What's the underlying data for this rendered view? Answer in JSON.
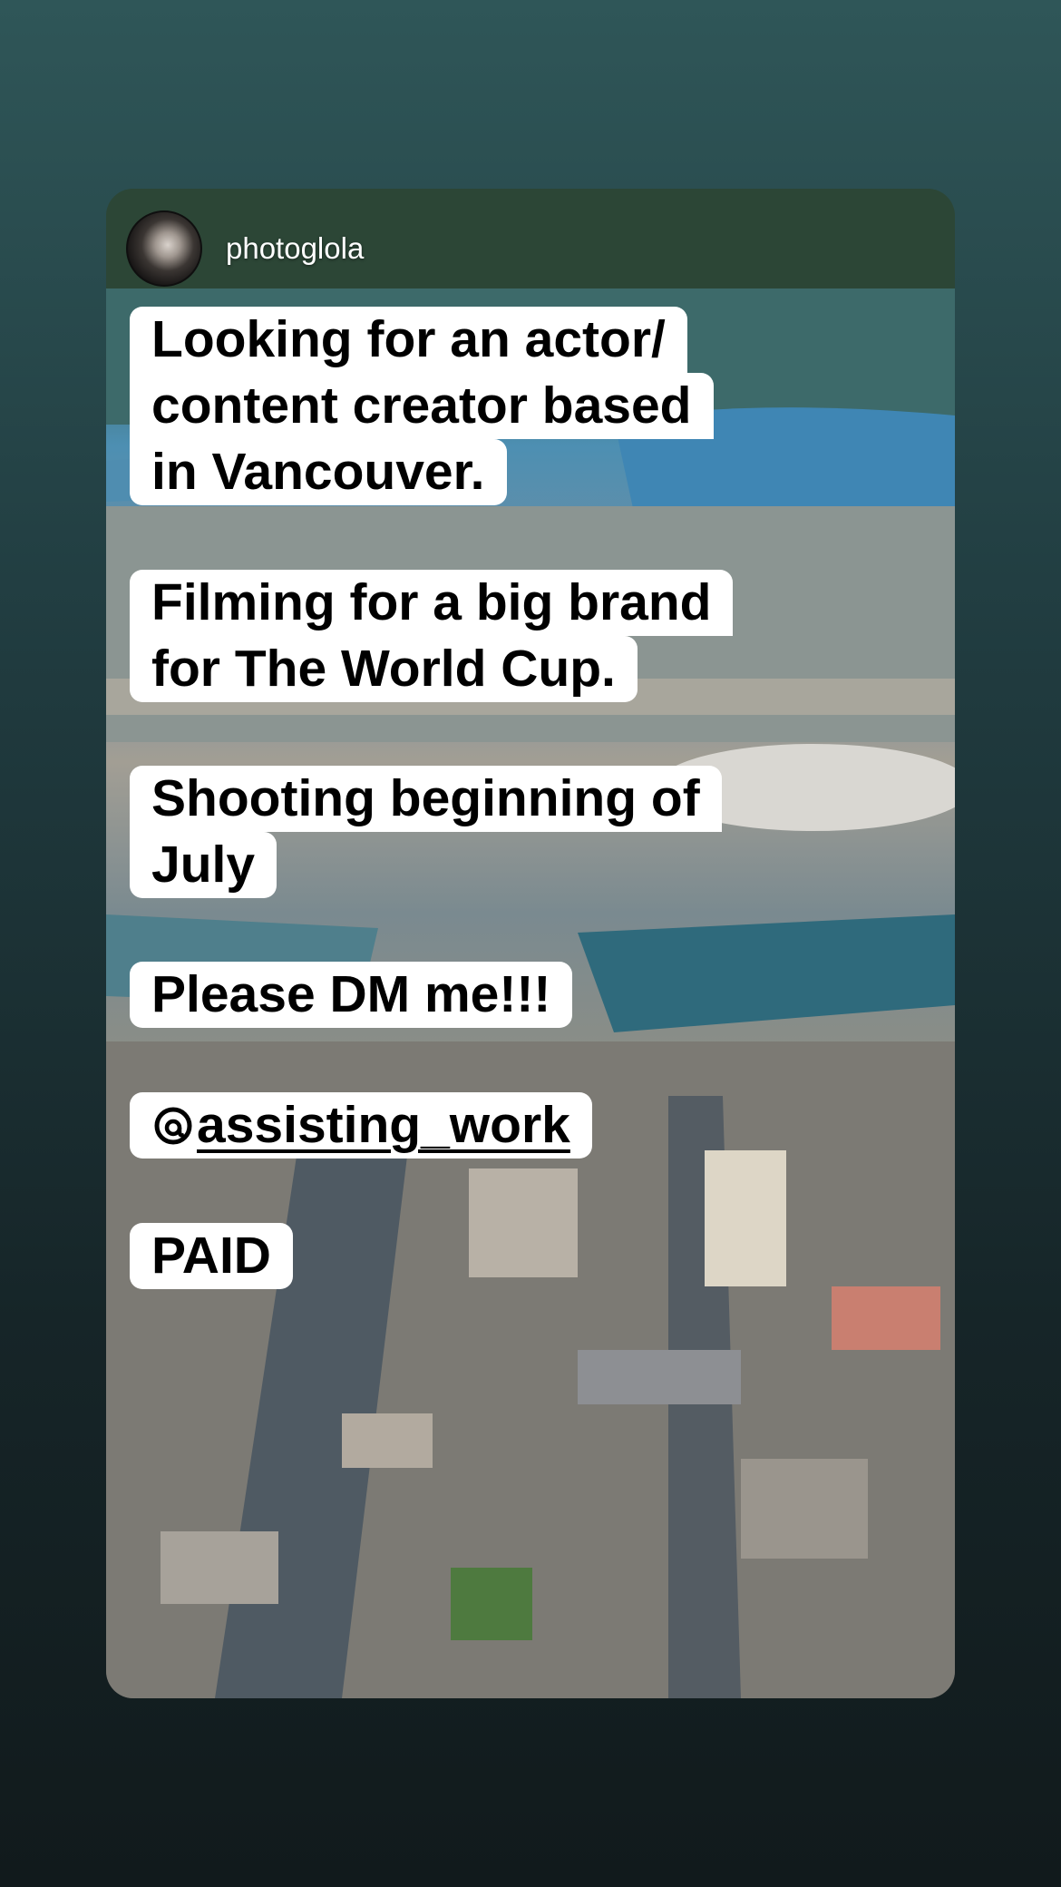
{
  "story": {
    "username": "photoglola",
    "text_blocks": [
      {
        "lines": [
          "Looking for an actor/",
          "content creator based",
          "in Vancouver."
        ]
      },
      {
        "lines": [
          "Filming for a big brand",
          "for The World Cup."
        ]
      },
      {
        "lines": [
          "Shooting beginning of",
          "July"
        ]
      },
      {
        "lines": [
          "Please DM me!!!"
        ]
      },
      {
        "lines": [
          "assisting_work"
        ]
      },
      {
        "lines": [
          "PAID"
        ]
      }
    ]
  },
  "colors": {
    "background_top": "#2f5658",
    "background_bottom": "#111a1c",
    "text_bg": "#ffffff",
    "text": "#000000"
  }
}
